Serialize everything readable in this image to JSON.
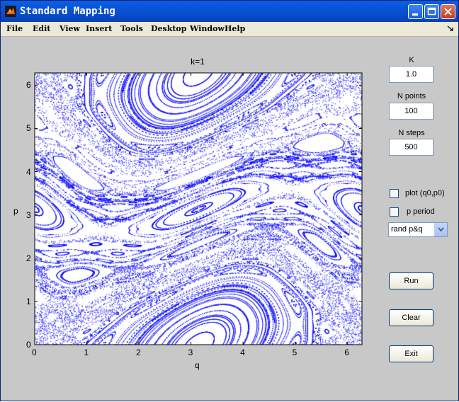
{
  "window": {
    "title": "Standard Mapping"
  },
  "menu": [
    "File",
    "Edit",
    "View",
    "Insert",
    "Tools",
    "Desktop",
    "Window",
    "Help"
  ],
  "plot": {
    "title": "k=1",
    "xlabel": "q",
    "ylabel": "p",
    "xticks": [
      "0",
      "1",
      "2",
      "3",
      "4",
      "5",
      "6"
    ],
    "yticks": [
      "0",
      "1",
      "2",
      "3",
      "4",
      "5",
      "6"
    ],
    "xlim": [
      0,
      6.283
    ],
    "ylim": [
      0,
      6.283
    ],
    "point_color": "#0000ff"
  },
  "controls": {
    "k_label": "K",
    "k_value": "1.0",
    "npoints_label": "N points",
    "npoints_value": "100",
    "nsteps_label": "N steps",
    "nsteps_value": "500",
    "plot_checkbox_label": "plot (q0,p0)",
    "period_checkbox_label": "p period",
    "mode_selected": "rand p&q",
    "run_label": "Run",
    "clear_label": "Clear",
    "exit_label": "Exit"
  }
}
